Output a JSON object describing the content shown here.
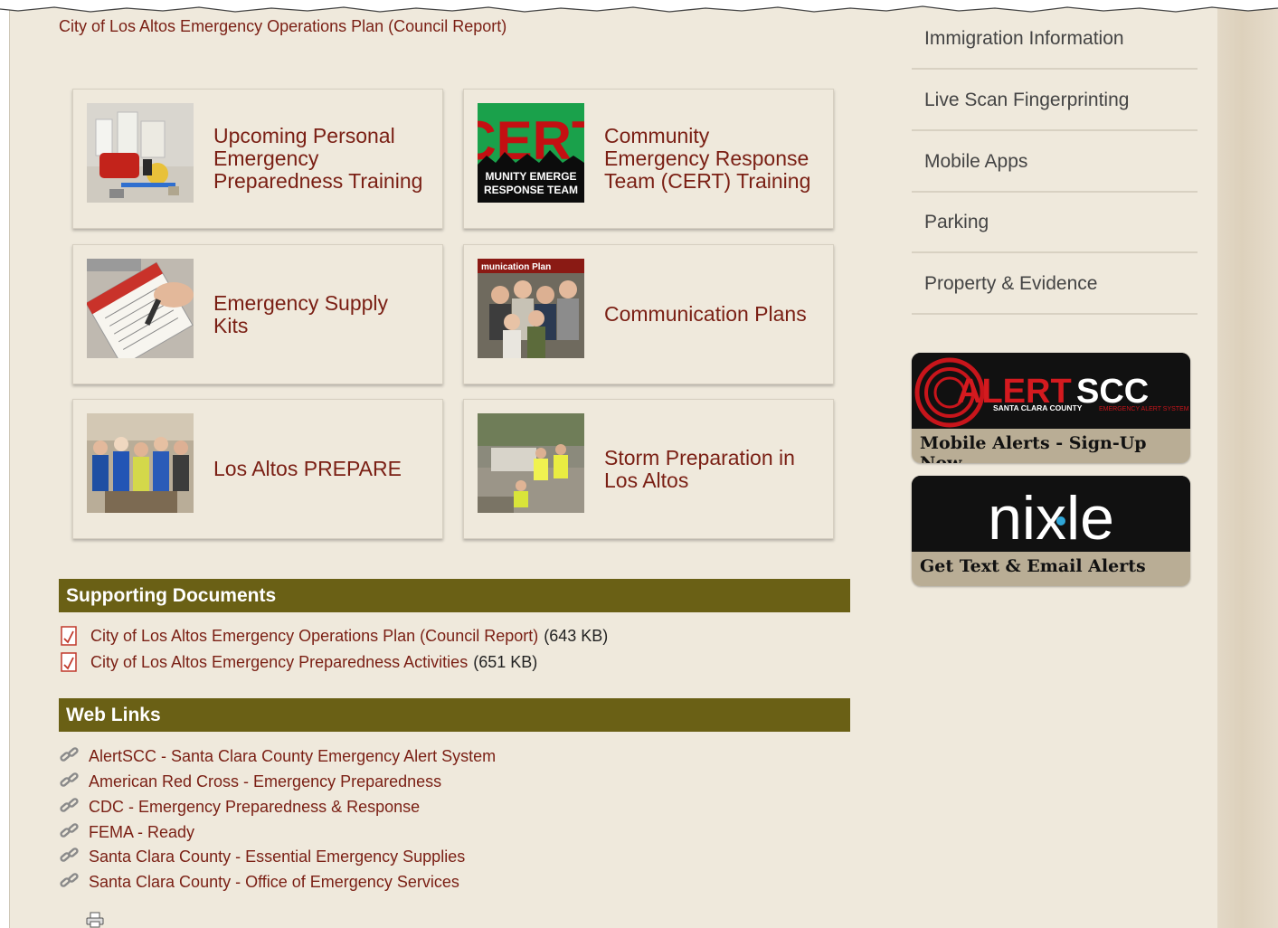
{
  "breadcrumb": {
    "text": "City of Los Altos Emergency Operations Plan (Council Report)"
  },
  "tiles": [
    {
      "title": "Upcoming Personal Emergency Preparedness Training",
      "icon": "supplies-photo"
    },
    {
      "title": "Community Emergency Response Team (CERT) Training",
      "icon": "cert-logo",
      "logo_text": "CERT",
      "logo_sub1": "MUNITY EMERGE",
      "logo_sub2": "RESPONSE TEAM"
    },
    {
      "title": "Emergency Supply Kits",
      "icon": "checklist-photo"
    },
    {
      "title": "Communication Plans",
      "icon": "family-photo",
      "photo_caption": "munication Plan"
    },
    {
      "title": "Los Altos PREPARE",
      "icon": "volunteers-photo"
    },
    {
      "title": "Storm Preparation in Los Altos",
      "icon": "storm-workers-photo"
    }
  ],
  "supporting_documents": {
    "heading": "Supporting Documents",
    "items": [
      {
        "label": "City of Los Altos Emergency Operations Plan (Council Report)",
        "size": "(643 KB)"
      },
      {
        "label": "City of Los Altos Emergency Preparedness Activities",
        "size": "(651 KB)"
      }
    ]
  },
  "web_links": {
    "heading": "Web Links",
    "items": [
      "AlertSCC - Santa Clara County Emergency Alert System",
      "American Red Cross - Emergency Preparedness",
      "CDC - Emergency Preparedness & Response",
      "FEMA - Ready",
      "Santa Clara County - Essential Emergency Supplies",
      "Santa Clara County - Office of Emergency Services"
    ]
  },
  "sidebar": {
    "items": [
      "Immigration Information",
      "Live Scan Fingerprinting",
      "Mobile Apps",
      "Parking",
      "Property & Evidence"
    ]
  },
  "alertscc": {
    "logo_text_a": "ALERT",
    "logo_text_b": "SCC",
    "tagline_a": "SANTA CLARA COUNTY",
    "tagline_b": "EMERGENCY ALERT SYSTEM",
    "cta": "Mobile Alerts - Sign-Up Now"
  },
  "nixle": {
    "logo_text": "nixle",
    "cta": "Get Text & Email Alerts"
  },
  "colors": {
    "link": "#7a1f14",
    "section_bar": "#6a6015",
    "page_bg": "#efe9dc"
  }
}
